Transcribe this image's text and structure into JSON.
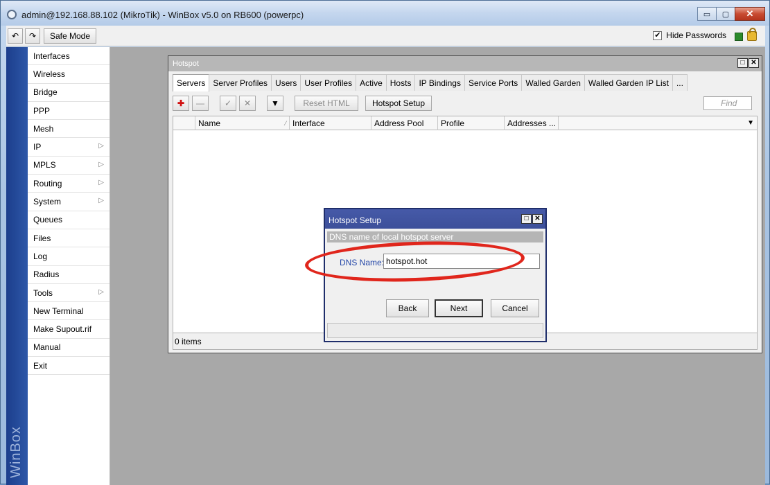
{
  "window": {
    "title": "admin@192.168.88.102 (MikroTik) - WinBox v5.0 on RB600 (powerpc)",
    "min_glyph": "▭",
    "max_glyph": "▢",
    "close_glyph": "✕"
  },
  "toolbar": {
    "undo_glyph": "↶",
    "redo_glyph": "↷",
    "safe_mode_label": "Safe Mode",
    "hide_passwords_label": "Hide Passwords",
    "hide_passwords_checked": "✔"
  },
  "sidebar": {
    "brand": "WinBox",
    "items": [
      {
        "label": "Interfaces",
        "arrow": ""
      },
      {
        "label": "Wireless",
        "arrow": ""
      },
      {
        "label": "Bridge",
        "arrow": ""
      },
      {
        "label": "PPP",
        "arrow": ""
      },
      {
        "label": "Mesh",
        "arrow": ""
      },
      {
        "label": "IP",
        "arrow": "▷"
      },
      {
        "label": "MPLS",
        "arrow": "▷"
      },
      {
        "label": "Routing",
        "arrow": "▷"
      },
      {
        "label": "System",
        "arrow": "▷"
      },
      {
        "label": "Queues",
        "arrow": ""
      },
      {
        "label": "Files",
        "arrow": ""
      },
      {
        "label": "Log",
        "arrow": ""
      },
      {
        "label": "Radius",
        "arrow": ""
      },
      {
        "label": "Tools",
        "arrow": "▷"
      },
      {
        "label": "New Terminal",
        "arrow": ""
      },
      {
        "label": "Make Supout.rif",
        "arrow": ""
      },
      {
        "label": "Manual",
        "arrow": ""
      },
      {
        "label": "Exit",
        "arrow": ""
      }
    ]
  },
  "hotspot": {
    "title": "Hotspot",
    "restore_glyph": "□",
    "close_glyph": "✕",
    "tabs": [
      "Servers",
      "Server Profiles",
      "Users",
      "User Profiles",
      "Active",
      "Hosts",
      "IP Bindings",
      "Service Ports",
      "Walled Garden",
      "Walled Garden IP List",
      "..."
    ],
    "active_tab": "Servers",
    "buttons": {
      "add": "✚",
      "remove": "—",
      "enable": "✓",
      "disable": "✕",
      "filter": "▼",
      "reset_html": "Reset HTML",
      "hotspot_setup": "Hotspot Setup"
    },
    "find_placeholder": "Find",
    "columns": [
      "",
      "Name",
      "Interface",
      "Address Pool",
      "Profile",
      "Addresses ..."
    ],
    "sort_glyph": "⁄",
    "dropdown_glyph": "▼",
    "status": "0 items"
  },
  "setup_dialog": {
    "title": "Hotspot Setup",
    "restore_glyph": "□",
    "close_glyph": "✕",
    "description": "DNS name of local hotspot server",
    "dns_label": "DNS Name:",
    "dns_value": "hotspot.hot",
    "back_label": "Back",
    "next_label": "Next",
    "cancel_label": "Cancel",
    "highlight_color": "#e0261c"
  }
}
